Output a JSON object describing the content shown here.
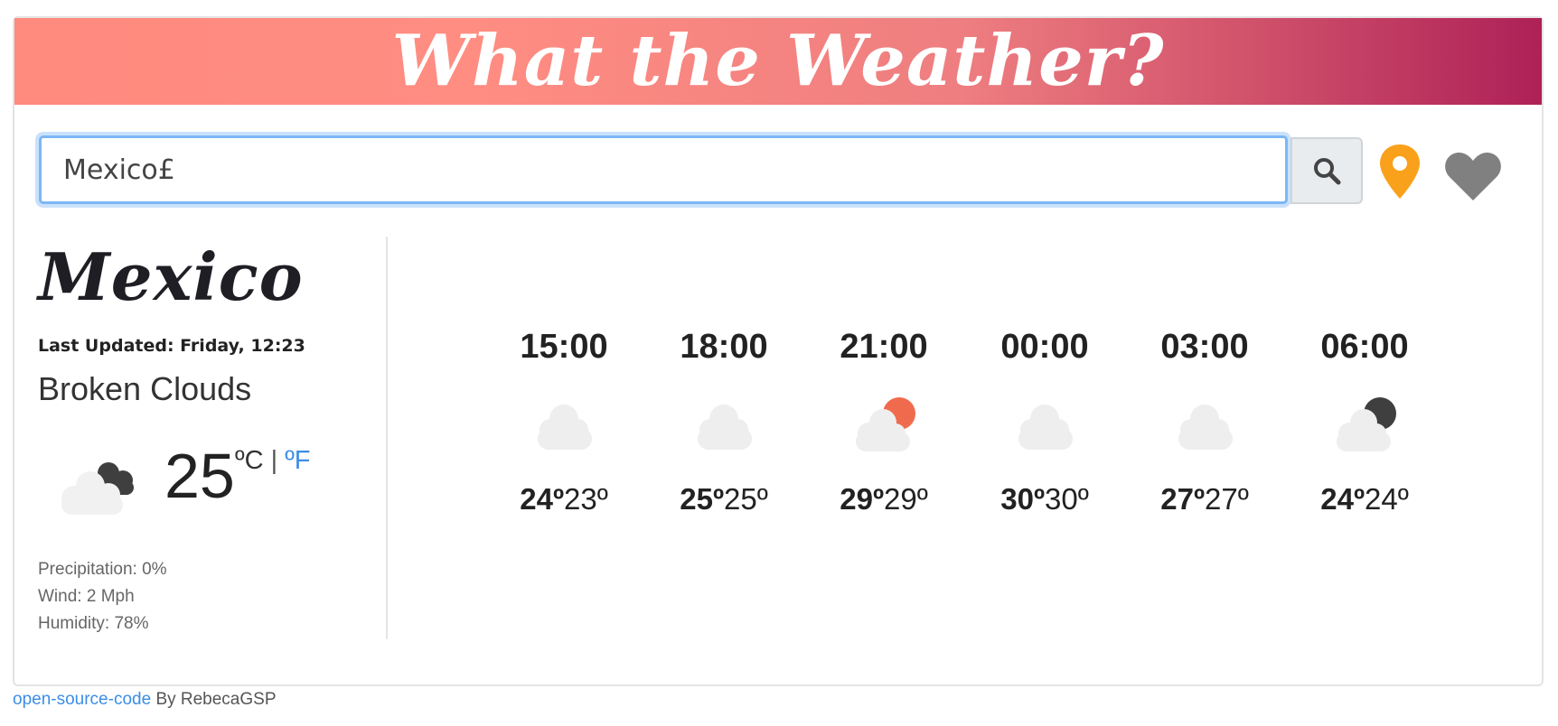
{
  "header": {
    "title": "What the Weather?"
  },
  "search": {
    "value": "Mexico£",
    "button_icon": "search-icon"
  },
  "actions": {
    "location_icon": "map-pin-icon",
    "favorite_icon": "heart-icon"
  },
  "colors": {
    "accent": "#3b8ee6",
    "pin": "#f9a11b",
    "heart": "#808080",
    "sun": "#f06b4d"
  },
  "current": {
    "city": "Mexico",
    "last_updated": "Last Updated: Friday, 12:23",
    "description": "Broken Clouds",
    "icon": "cloud-night-icon",
    "temperature": "25",
    "unit_c": "ºC",
    "unit_sep": "|",
    "unit_f": "ºF",
    "precipitation": "Precipitation: 0%",
    "wind": "Wind: 2 Mph",
    "humidity": "Humidity: 78%"
  },
  "forecast": [
    {
      "time": "15:00",
      "icon": "cloud-icon",
      "max": "24º",
      "min": "23º"
    },
    {
      "time": "18:00",
      "icon": "cloud-icon",
      "max": "25º",
      "min": "25º"
    },
    {
      "time": "21:00",
      "icon": "cloud-sun-icon",
      "max": "29º",
      "min": "29º"
    },
    {
      "time": "00:00",
      "icon": "cloud-icon",
      "max": "30º",
      "min": "30º"
    },
    {
      "time": "03:00",
      "icon": "cloud-icon",
      "max": "27º",
      "min": "27º"
    },
    {
      "time": "06:00",
      "icon": "cloud-moon-icon",
      "max": "24º",
      "min": "24º"
    }
  ],
  "footer": {
    "link_text": "open-source-code",
    "by_text": "By RebecaGSP"
  }
}
